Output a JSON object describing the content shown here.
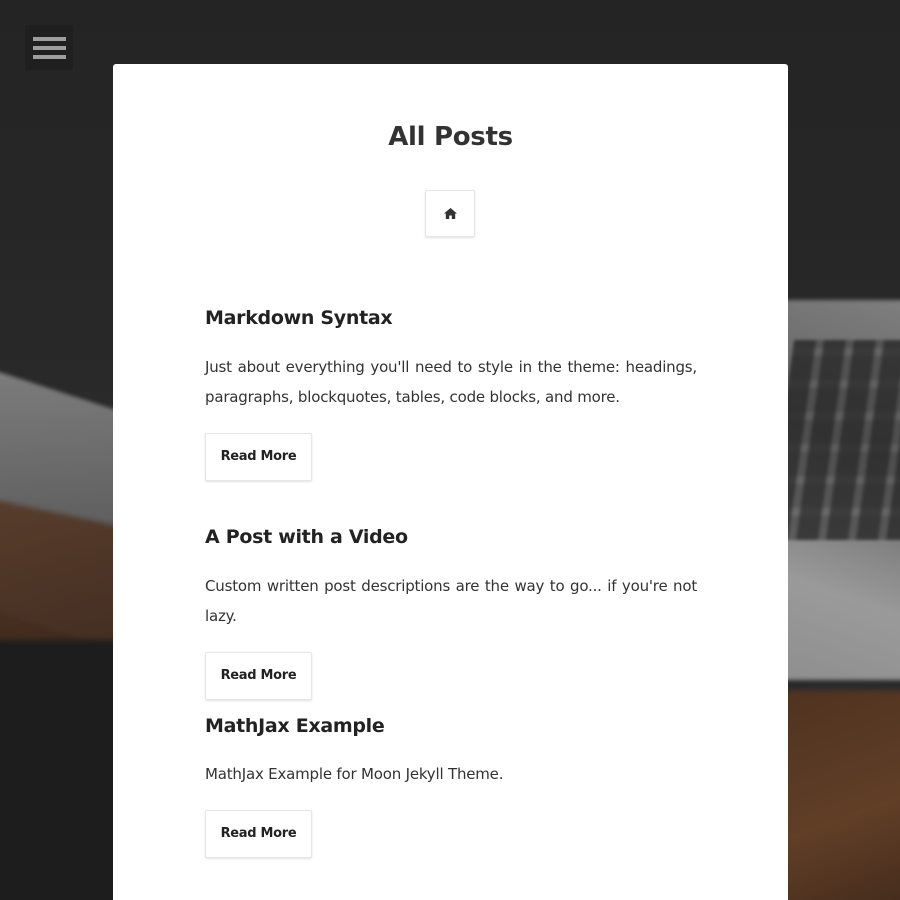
{
  "nav": {
    "menu_icon": "hamburger-menu-icon"
  },
  "page": {
    "title": "All Posts",
    "home_icon": "home-icon"
  },
  "posts": [
    {
      "title": "Markdown Syntax",
      "description": "Just about everything you'll need to style in the theme: headings, paragraphs, blockquotes, tables, code blocks, and more.",
      "button_label": "Read More"
    },
    {
      "title": "A Post with a Video",
      "description": "Custom written post descriptions are the way to go... if you're not lazy.",
      "button_label": "Read More"
    },
    {
      "title": "MathJax Example",
      "description": "MathJax Example for Moon Jekyll Theme.",
      "button_label": "Read More"
    }
  ],
  "colors": {
    "card_background": "#ffffff",
    "heading_text": "#333333",
    "body_text": "#333333",
    "menu_button_bg": "#1f1f1f",
    "menu_bars": "#9d9d9d"
  }
}
